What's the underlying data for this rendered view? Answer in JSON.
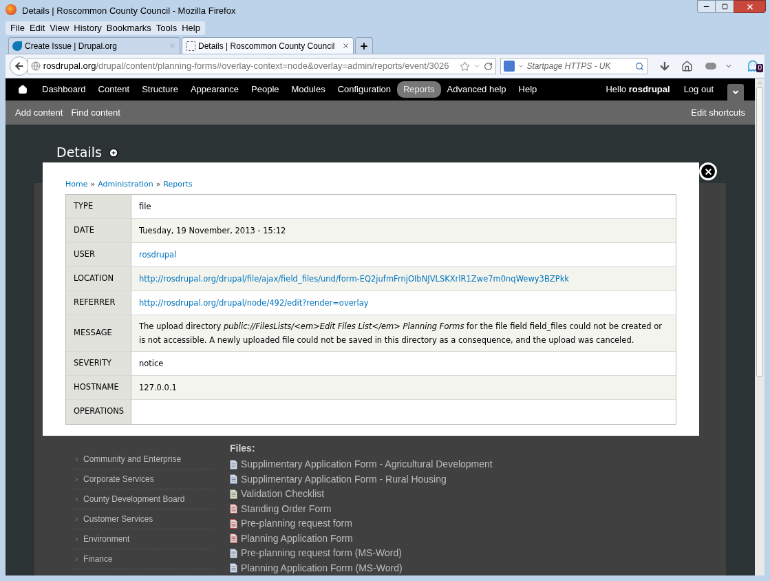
{
  "window": {
    "title": "Details | Roscommon County Council - Mozilla Firefox"
  },
  "menu": [
    "File",
    "Edit",
    "View",
    "History",
    "Bookmarks",
    "Tools",
    "Help"
  ],
  "tabs": [
    {
      "label": "Create Issue | Drupal.org",
      "selected": false
    },
    {
      "label": "Details | Roscommon County Council",
      "selected": true
    }
  ],
  "address_bar": {
    "domain": "rosdrupal.org",
    "path": "/drupal/content/planning-forms#overlay-context=node&overlay=admin/reports/event/3026"
  },
  "search": {
    "placeholder": "Startpage HTTPS - UK"
  },
  "addon_badge": "0",
  "toolbar": {
    "items": [
      {
        "label": "Dashboard",
        "selected": false
      },
      {
        "label": "Content",
        "selected": false
      },
      {
        "label": "Structure",
        "selected": false
      },
      {
        "label": "Appearance",
        "selected": false
      },
      {
        "label": "People",
        "selected": false
      },
      {
        "label": "Modules",
        "selected": false
      },
      {
        "label": "Configuration",
        "selected": false
      },
      {
        "label": "Reports",
        "selected": true
      },
      {
        "label": "Advanced help",
        "selected": false
      },
      {
        "label": "Help",
        "selected": false
      }
    ],
    "greeting": "Hello **rosdrupal**",
    "logout": "Log out"
  },
  "shortcuts": {
    "items": [
      "Add content",
      "Find content"
    ],
    "edit": "Edit shortcuts"
  },
  "page": {
    "title": "Details",
    "sidebar": [
      "Community and Enterprise",
      "Corporate Services",
      "County Development Board",
      "Customer Services",
      "Environment",
      "Finance"
    ],
    "files_heading": "Files:",
    "files": [
      {
        "name": "Supplimentary Application Form - Agricultural Development",
        "kind": "doc"
      },
      {
        "name": "Supplimentary Application Form - Rural Housing",
        "kind": "doc"
      },
      {
        "name": "Validation Checklist",
        "kind": "sheet"
      },
      {
        "name": "Standing Order Form",
        "kind": "pdf"
      },
      {
        "name": "Pre-planning request form",
        "kind": "pdf"
      },
      {
        "name": "Planning Application Form",
        "kind": "pdf"
      },
      {
        "name": "Pre-planning request form (MS-Word)",
        "kind": "doc"
      },
      {
        "name": "Planning Application Form (MS-Word)",
        "kind": "doc"
      }
    ]
  },
  "overlay": {
    "breadcrumb": [
      {
        "text": "Home",
        "kind": "link"
      },
      {
        "text": "»",
        "kind": "separator"
      },
      {
        "text": "Administration",
        "kind": "link"
      },
      {
        "text": "»",
        "kind": "separator"
      },
      {
        "text": "Reports",
        "kind": "link"
      }
    ],
    "rows": [
      {
        "label": "TYPE",
        "value": "file",
        "kind": "text"
      },
      {
        "label": "DATE",
        "value": "Tuesday, 19 November, 2013 - 15:12",
        "kind": "text"
      },
      {
        "label": "USER",
        "value": "rosdrupal",
        "kind": "link"
      },
      {
        "label": "LOCATION",
        "value": "http://rosdrupal.org/drupal/file/ajax/field_files/und/form-EQ2jufmFrnjOIbNJVLSKXrlR1Zwe7m0nqWewy3BZPkk",
        "kind": "link"
      },
      {
        "label": "REFERRER",
        "value": "http://rosdrupal.org/drupal/node/492/edit?render=overlay",
        "kind": "link"
      },
      {
        "label": "MESSAGE",
        "value": "The upload directory *public://FilesLists/<em>Edit Files List</em> Planning Forms* for the file field field_files could not be created or is not accessible. A newly uploaded file could not be saved in this directory as a consequence, and the upload was canceled.",
        "kind": "text"
      },
      {
        "label": "SEVERITY",
        "value": "notice",
        "kind": "text"
      },
      {
        "label": "HOSTNAME",
        "value": "127.0.0.1",
        "kind": "text"
      },
      {
        "label": "OPERATIONS",
        "value": "",
        "kind": "text"
      }
    ]
  }
}
